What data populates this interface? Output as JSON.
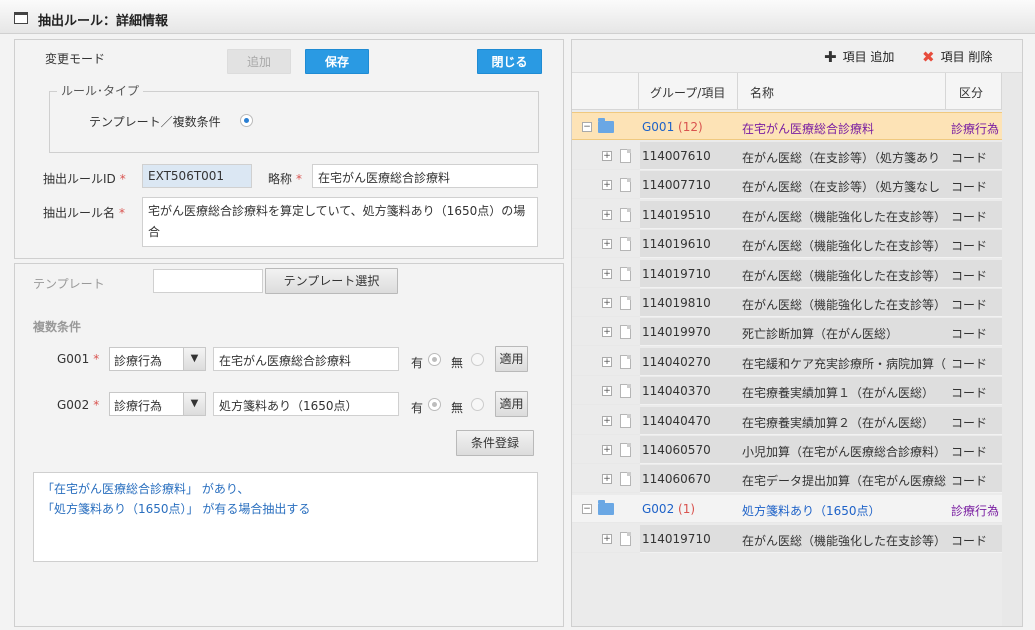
{
  "window": {
    "title": "抽出ルール：詳細情報",
    "icon": "window-icon"
  },
  "top": {
    "mode_label": "変更モード",
    "add_label": "追加",
    "save_label": "保存",
    "close_label": "閉じる",
    "rule_type_legend": "ルール･タイプ",
    "rule_type_option": "テンプレート／複数条件",
    "rule_id_label": "抽出ルールID",
    "rule_id_value": "EXT506T001",
    "short_name_label": "略称",
    "short_name_value": "在宅がん医療総合診療料",
    "rule_name_label": "抽出ルール名",
    "rule_name_value": "宅がん医療総合診療料を算定していて、処方箋料あり（1650点）の場合",
    "required_mark": "*"
  },
  "bottom": {
    "template_label": "テンプレート",
    "template_value": "",
    "template_select_label": "テンプレート選択",
    "multi_label": "複数条件",
    "conditions": [
      {
        "group": "G001",
        "type": "診療行為",
        "value": "在宅がん医療総合診療料",
        "yes": "有",
        "no": "無",
        "apply": "適用"
      },
      {
        "group": "G002",
        "type": "診療行為",
        "value": "処方箋料あり（1650点）",
        "yes": "有",
        "no": "無",
        "apply": "適用"
      }
    ],
    "register_label": "条件登録",
    "description": "「在宅がん医療総合診療料」 があり、\n「処方箋料あり（1650点）」 が有る場合抽出する",
    "description_line1": "「在宅がん医療総合診療料」 があり、",
    "description_line2": "「処方箋料あり（1650点）」 が有る場合抽出する"
  },
  "right": {
    "toolbar": {
      "add_item_label": "項目 追加",
      "delete_item_label": "項目 削除"
    },
    "columns": {
      "group_item": "グループ/項目",
      "name": "名称",
      "kind": "区分"
    },
    "groups": [
      {
        "code": "G001",
        "count": "(12)",
        "name": "在宅がん医療総合診療料",
        "kind": "診療行為"
      },
      {
        "code": "G002",
        "count": "(1)",
        "name": "処方箋料あり（1650点）",
        "kind": "診療行為"
      }
    ],
    "rows": [
      {
        "code": "114007610",
        "name": "在がん医総（在支診等）（処方箋あり",
        "kind": "コード"
      },
      {
        "code": "114007710",
        "name": "在がん医総（在支診等）（処方箋なし",
        "kind": "コード"
      },
      {
        "code": "114019510",
        "name": "在がん医総（機能強化した在支診等）",
        "kind": "コード"
      },
      {
        "code": "114019610",
        "name": "在がん医総（機能強化した在支診等）",
        "kind": "コード"
      },
      {
        "code": "114019710",
        "name": "在がん医総（機能強化した在支診等）",
        "kind": "コード"
      },
      {
        "code": "114019810",
        "name": "在がん医総（機能強化した在支診等）",
        "kind": "コード"
      },
      {
        "code": "114019970",
        "name": "死亡診断加算（在がん医総）",
        "kind": "コード"
      },
      {
        "code": "114040270",
        "name": "在宅緩和ケア充実診療所・病院加算（",
        "kind": "コード"
      },
      {
        "code": "114040370",
        "name": "在宅療養実績加算１（在がん医総）",
        "kind": "コード"
      },
      {
        "code": "114040470",
        "name": "在宅療養実績加算２（在がん医総）",
        "kind": "コード"
      },
      {
        "code": "114060570",
        "name": "小児加算（在宅がん医療総合診療料）",
        "kind": "コード"
      },
      {
        "code": "114060670",
        "name": "在宅データ提出加算（在宅がん医療総",
        "kind": "コード"
      },
      {
        "code": "114019710",
        "name": "在がん医総（機能強化した在支診等）",
        "kind": "コード"
      }
    ]
  },
  "colors": {
    "accent": "#2a9ae3",
    "group_highlight": "#fde3b6",
    "required": "#d9534f"
  }
}
